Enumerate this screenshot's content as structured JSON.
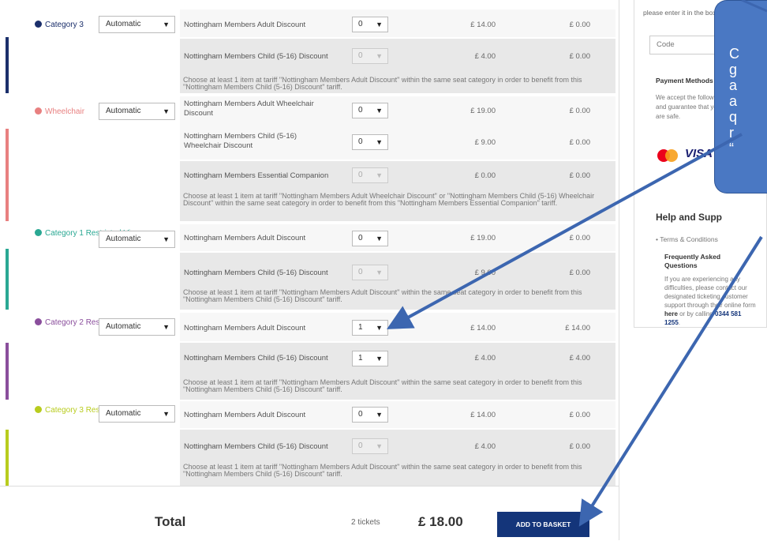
{
  "sidebar": {
    "intro": "please enter it in the box below.",
    "code_placeholder": "Code",
    "code_button": "G",
    "payment_title": "Payment Methods",
    "payment_text": "We accept the followi payment types and guarantee that your In transactions are safe.",
    "card_visa": "VISA",
    "help_title": "Help and Supp",
    "terms_link": "Terms & Conditions",
    "faq_title": "Frequently Asked Questions",
    "faq_text_1": "If you are experiencing any difficulties, please contact our designated ticketing customer support through their online form ",
    "faq_here": "here",
    "faq_text_2": " or by calling ",
    "faq_phone": "0344 581 1255",
    "faq_end": "."
  },
  "callout": {
    "lines": [
      "C",
      "g",
      "a",
      "a",
      "q",
      "r",
      "“"
    ]
  },
  "categories": [
    {
      "name": "Category 3",
      "color": "#1b2f6b",
      "mode": "Automatic",
      "tickets": [
        {
          "name": "Nottingham Members Adult Discount",
          "qty": "0",
          "price": "£ 14.00",
          "subtotal": "£ 0.00",
          "disabled": false
        },
        {
          "name": "Nottingham Members Child (5-16) Discount",
          "qty": "0",
          "price": "£ 4.00",
          "subtotal": "£ 0.00",
          "disabled": true
        }
      ],
      "note": "Choose at least 1 item at tariff \"Nottingham Members Adult Discount\" within the same seat category in order to benefit from this \"Nottingham Members Child (5-16) Discount\" tariff."
    },
    {
      "name": "Wheelchair",
      "color": "#e88080",
      "mode": "Automatic",
      "tickets": [
        {
          "name": "Nottingham Members Adult Wheelchair Discount",
          "qty": "0",
          "price": "£ 19.00",
          "subtotal": "£ 0.00",
          "disabled": false
        },
        {
          "name": "Nottingham Members Child (5-16) Wheelchair Discount",
          "qty": "0",
          "price": "£ 9.00",
          "subtotal": "£ 0.00",
          "disabled": false
        },
        {
          "name": "Nottingham Members Essential Companion",
          "qty": "0",
          "price": "£ 0.00",
          "subtotal": "£ 0.00",
          "disabled": true
        }
      ],
      "note": "Choose at least 1 item at tariff \"Nottingham Members Adult Wheelchair Discount\" or \"Nottingham Members Child (5-16) Wheelchair Discount\" within the same seat category in order to benefit from this \"Nottingham Members Essential Companion\" tariff."
    },
    {
      "name": "Category 1 Restricted View",
      "color": "#2aa893",
      "mode": "Automatic",
      "tickets": [
        {
          "name": "Nottingham Members Adult Discount",
          "qty": "0",
          "price": "£ 19.00",
          "subtotal": "£ 0.00",
          "disabled": false
        },
        {
          "name": "Nottingham Members Child (5-16) Discount",
          "qty": "0",
          "price": "£ 9.00",
          "subtotal": "£ 0.00",
          "disabled": true
        }
      ],
      "note": "Choose at least 1 item at tariff \"Nottingham Members Adult Discount\" within the same seat category in order to benefit from this \"Nottingham Members Child (5-16) Discount\" tariff."
    },
    {
      "name": "Category 2 Restricted View",
      "color": "#8a4e9c",
      "mode": "Automatic",
      "tickets": [
        {
          "name": "Nottingham Members Adult Discount",
          "qty": "1",
          "price": "£ 14.00",
          "subtotal": "£ 14.00",
          "disabled": false
        },
        {
          "name": "Nottingham Members Child (5-16) Discount",
          "qty": "1",
          "price": "£ 4.00",
          "subtotal": "£ 4.00",
          "disabled": false
        }
      ],
      "note": "Choose at least 1 item at tariff \"Nottingham Members Adult Discount\" within the same seat category in order to benefit from this \"Nottingham Members Child (5-16) Discount\" tariff."
    },
    {
      "name": "Category 3 Restricted View",
      "color": "#b8cc1e",
      "mode": "Automatic",
      "tickets": [
        {
          "name": "Nottingham Members Adult Discount",
          "qty": "0",
          "price": "£ 14.00",
          "subtotal": "£ 0.00",
          "disabled": false
        },
        {
          "name": "Nottingham Members Child (5-16) Discount",
          "qty": "0",
          "price": "£ 4.00",
          "subtotal": "£ 0.00",
          "disabled": true
        }
      ],
      "note": "Choose at least 1 item at tariff \"Nottingham Members Adult Discount\" within the same seat category in order to benefit from this \"Nottingham Members Child (5-16) Discount\" tariff."
    }
  ],
  "footer": {
    "total_label": "Total",
    "tickets_count": "2 tickets",
    "total_amount": "£ 18.00",
    "add_button": "ADD TO BASKET"
  }
}
